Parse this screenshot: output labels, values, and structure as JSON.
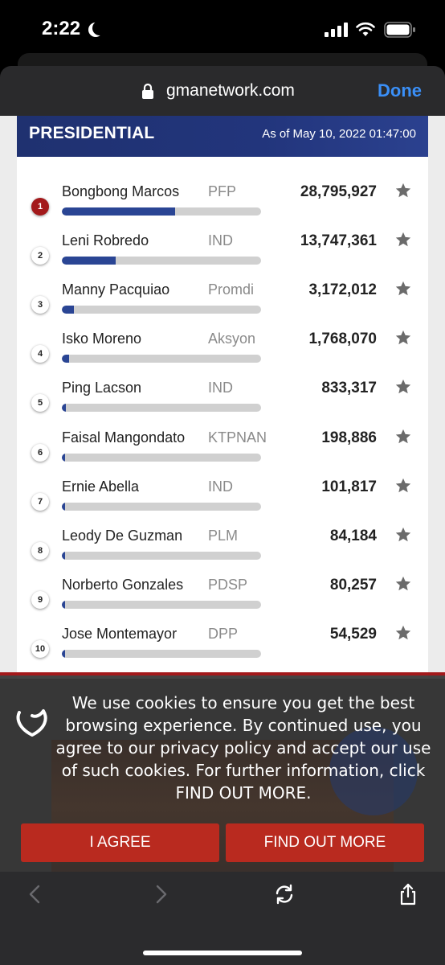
{
  "status_bar": {
    "time": "2:22"
  },
  "browser": {
    "url": "gmanetwork.com",
    "done_label": "Done"
  },
  "panel": {
    "title": "PRESIDENTIAL",
    "as_of": "As of May 10, 2022 01:47:00"
  },
  "candidates": [
    {
      "rank": "1",
      "name": "Bongbong Marcos",
      "party": "PFP",
      "votes": "28,795,927",
      "bar_fraction": 0.57
    },
    {
      "rank": "2",
      "name": "Leni Robredo",
      "party": "IND",
      "votes": "13,747,361",
      "bar_fraction": 0.27
    },
    {
      "rank": "3",
      "name": "Manny Pacquiao",
      "party": "Promdi",
      "votes": "3,172,012",
      "bar_fraction": 0.06
    },
    {
      "rank": "4",
      "name": "Isko Moreno",
      "party": "Aksyon",
      "votes": "1,768,070",
      "bar_fraction": 0.035
    },
    {
      "rank": "5",
      "name": "Ping Lacson",
      "party": "IND",
      "votes": "833,317",
      "bar_fraction": 0.02
    },
    {
      "rank": "6",
      "name": "Faisal Mangondato",
      "party": "KTPNAN",
      "votes": "198,886",
      "bar_fraction": 0.012
    },
    {
      "rank": "7",
      "name": "Ernie Abella",
      "party": "IND",
      "votes": "101,817",
      "bar_fraction": 0.012
    },
    {
      "rank": "8",
      "name": "Leody De Guzman",
      "party": "PLM",
      "votes": "84,184",
      "bar_fraction": 0.012
    },
    {
      "rank": "9",
      "name": "Norberto Gonzales",
      "party": "PDSP",
      "votes": "80,257",
      "bar_fraction": 0.012
    },
    {
      "rank": "10",
      "name": "Jose Montemayor",
      "party": "DPP",
      "votes": "54,529",
      "bar_fraction": 0.012
    }
  ],
  "cookie_banner": {
    "text": "We use cookies to ensure you get the best browsing experience. By continued use, you agree to our privacy policy and accept our use of such cookies. For further information, click FIND OUT MORE.",
    "agree_label": "I AGREE",
    "more_label": "FIND OUT MORE"
  },
  "colors": {
    "accent_blue": "#2a4594",
    "header_navy": "#1f3170",
    "brand_red": "#a3191b",
    "done_blue": "#3a8ff7"
  },
  "icons": [
    "moon-icon",
    "signal-icon",
    "wifi-icon",
    "battery-icon",
    "lock-icon",
    "star-icon",
    "heart-logo",
    "back-icon",
    "forward-icon",
    "reload-icon",
    "share-icon"
  ]
}
